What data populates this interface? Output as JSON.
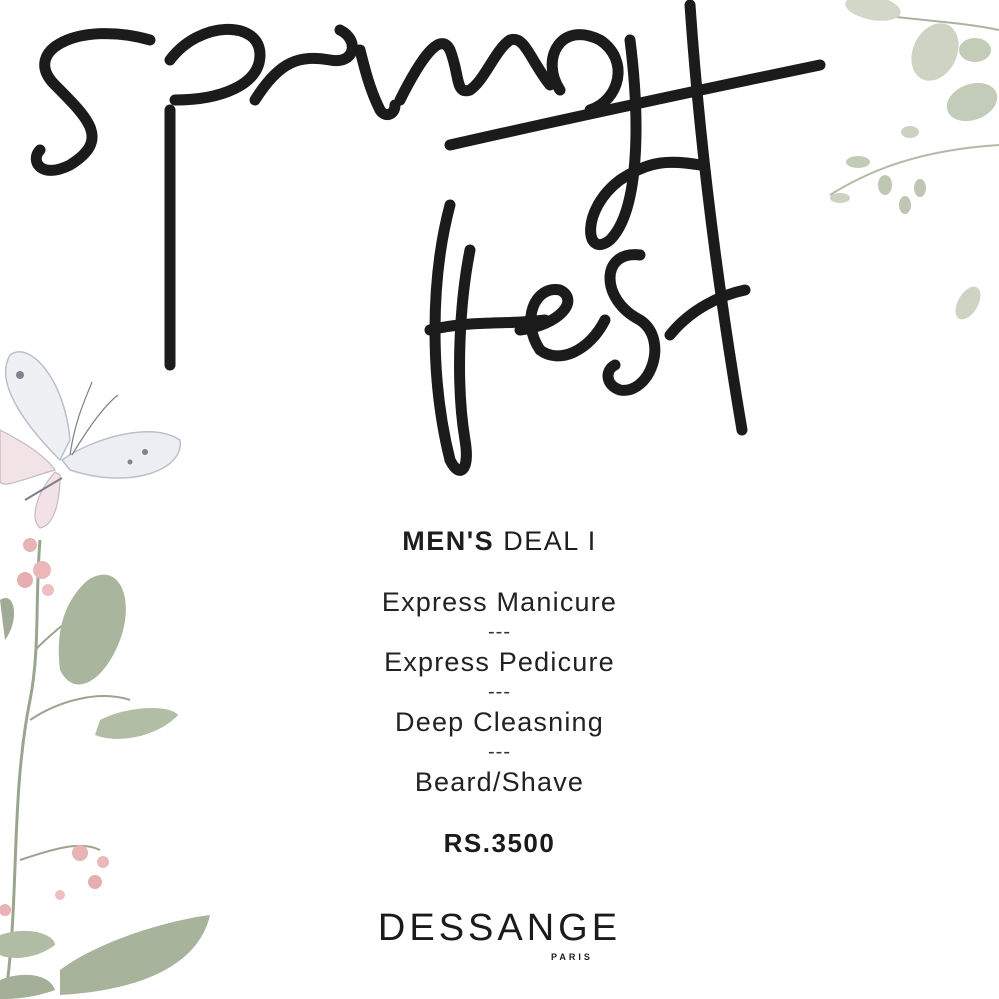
{
  "headline": {
    "line1": "spring",
    "line2": "fest"
  },
  "deal": {
    "title_strong": "MEN'S",
    "title_light": "DEAL I"
  },
  "services": [
    "Express Manicure",
    "Express Pedicure",
    "Deep Cleasning",
    "Beard/Shave"
  ],
  "separator": "---",
  "price": "RS.3500",
  "brand": {
    "name": "DESSANGE",
    "sub": "PARIS"
  },
  "colors": {
    "ink": "#1b1b1b",
    "leaf": "#a9b59c",
    "blossom": "#e8b3b5",
    "background": "#ffffff"
  },
  "icons": [
    "butterfly-illustration",
    "leaf-branch-illustration",
    "blossom-illustration"
  ]
}
